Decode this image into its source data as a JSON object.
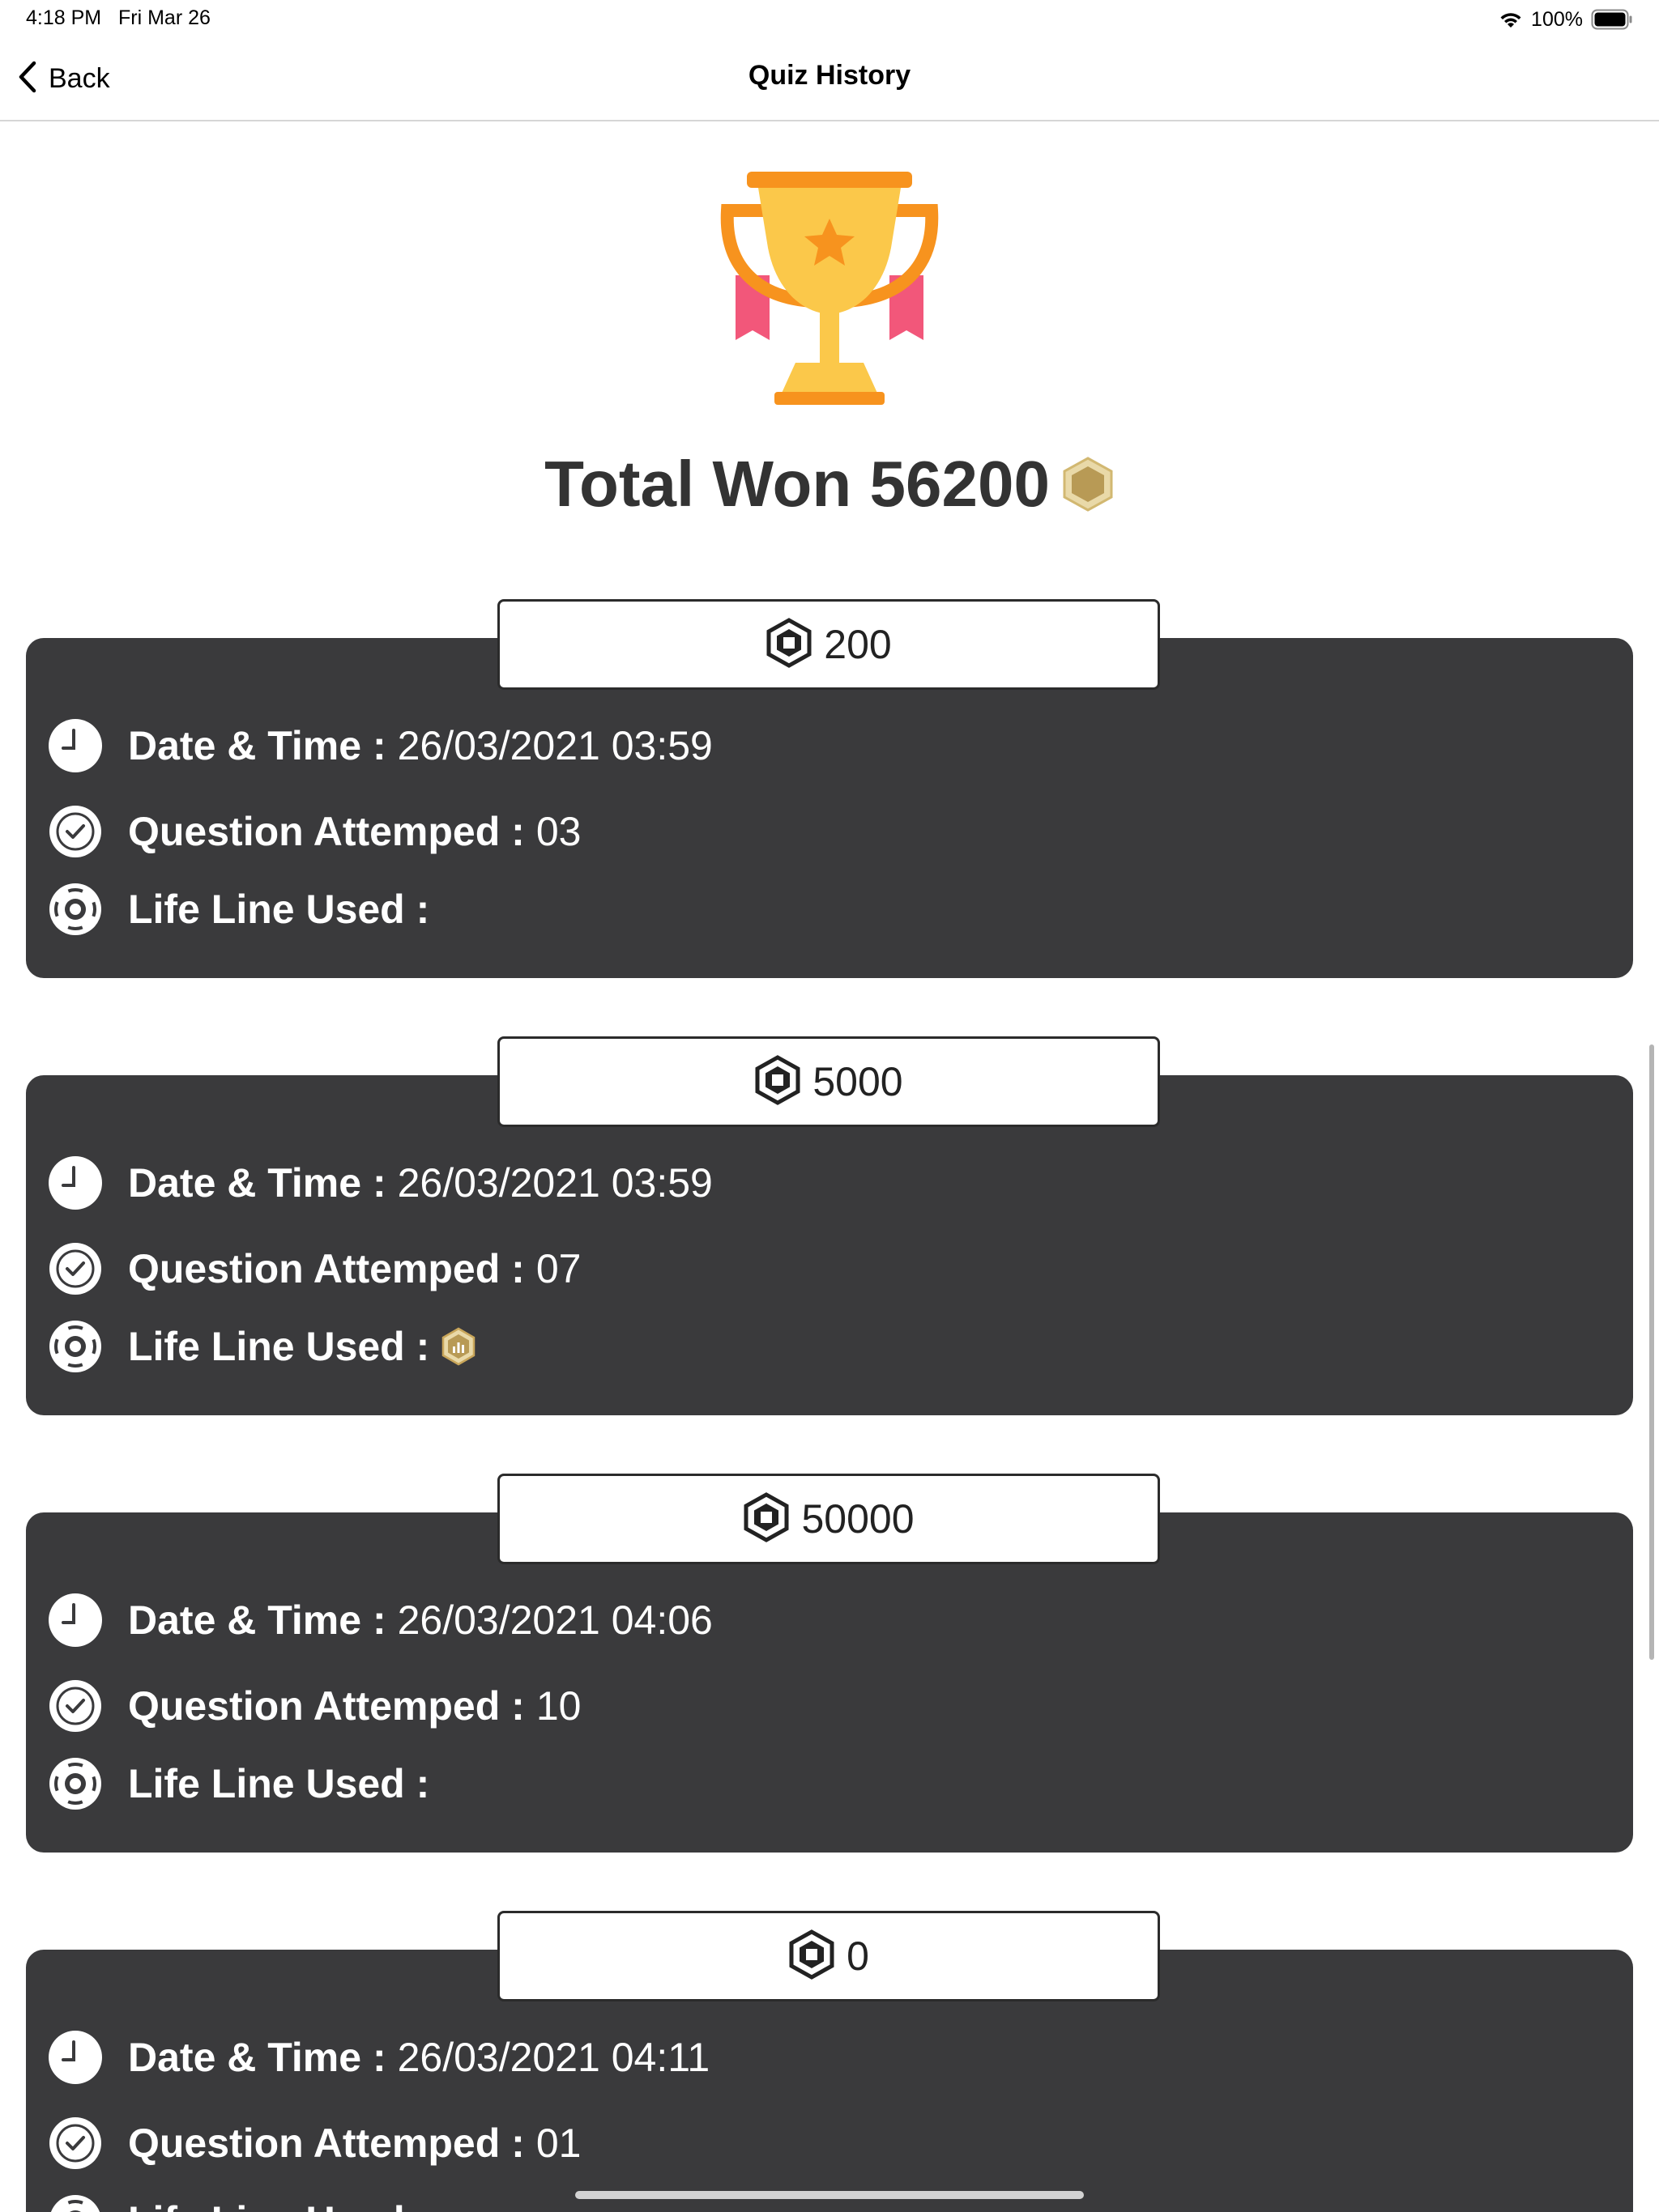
{
  "status_bar": {
    "time": "4:18 PM",
    "date": "Fri Mar 26",
    "battery": "100%"
  },
  "nav": {
    "back_label": "Back",
    "title": "Quiz History"
  },
  "summary": {
    "total_text": "Total Won 56200",
    "trophy_icon": "trophy-icon",
    "coin_icon": "gold-hexagon-coin-icon"
  },
  "labels": {
    "date_time": "Date & Time :",
    "questions": "Question Attemped :",
    "lifeline": "Life Line Used :"
  },
  "history": [
    {
      "amount": "200",
      "date_time": "26/03/2021 03:59",
      "questions": "03",
      "lifeline_icon": ""
    },
    {
      "amount": "5000",
      "date_time": "26/03/2021 03:59",
      "questions": "07",
      "lifeline_icon": "audience-poll-lifeline-icon"
    },
    {
      "amount": "50000",
      "date_time": "26/03/2021 04:06",
      "questions": "10",
      "lifeline_icon": ""
    },
    {
      "amount": "0",
      "date_time": "26/03/2021 04:11",
      "questions": "01",
      "lifeline_icon": ""
    }
  ],
  "colors": {
    "card_bg": "#3a3a3c",
    "text_dark": "#333333",
    "coin_gold": "#c9a65a",
    "trophy_cup": "#f9c74a",
    "trophy_handle": "#f7931e",
    "ribbon": "#f2577a"
  }
}
